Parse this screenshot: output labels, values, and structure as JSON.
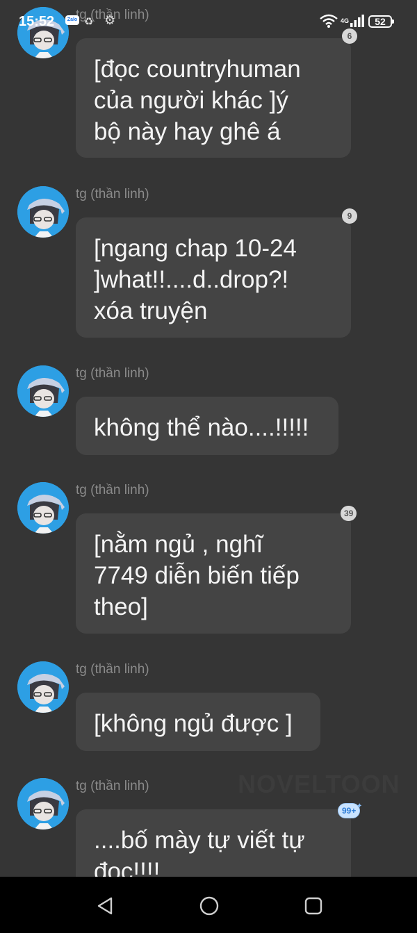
{
  "status_bar": {
    "time": "15:52",
    "zalo_label": "Zalo",
    "network": "4G",
    "battery": "52",
    "icons": [
      "zalo-icon",
      "recycle-icon",
      "gear-icon",
      "wifi-icon",
      "signal-icon",
      "battery-icon"
    ]
  },
  "messages": [
    {
      "sender": "tg (thần linh)",
      "text": "[đọc countryhuman\ncủa người khác ]ý\nbộ này hay ghê á",
      "reactions": "6"
    },
    {
      "sender": "tg (thần linh)",
      "text": "[ngang chap 10-24\n]what!!....d..drop?!\nxóa truyện",
      "reactions": "9"
    },
    {
      "sender": "tg (thần linh)",
      "text": "không thể nào....!!!!!",
      "reactions": ""
    },
    {
      "sender": "tg (thần linh)",
      "text": "[nằm ngủ , nghĩ\n7749 diễn biến tiếp\ntheo]",
      "reactions": "39"
    },
    {
      "sender": "tg (thần linh)",
      "text": "[không ngủ được ]",
      "reactions": ""
    },
    {
      "sender": "tg (thần linh)",
      "text": "....bố mày tự viết tự\nđọc!!!!",
      "reactions": "99+"
    }
  ],
  "watermark": "NOVELTOON",
  "nav_bar": {
    "icons": [
      "back-icon",
      "home-icon",
      "recents-icon"
    ]
  },
  "colors": {
    "background": "#353535",
    "bubble": "#444444",
    "avatar_bg": "#2d9fe4",
    "sender_text": "#8a8a8a",
    "message_text": "#f4f4f4",
    "badge": "#d8d8d8",
    "badge_hot": "#c9e3ff"
  }
}
